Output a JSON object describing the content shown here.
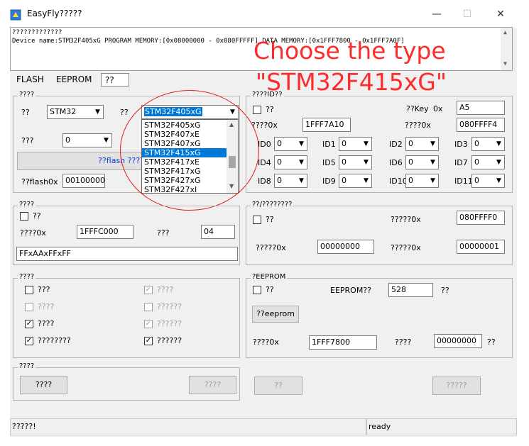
{
  "window": {
    "title": "EasyFly?????",
    "minimize": "—",
    "maximize": "☐",
    "close": "✕"
  },
  "log": {
    "lines": [
      "?????????????",
      "Device name:STM32F405xG PROGRAM MEMORY:[0x08000000 - 0x080FFFFF] DATA MEMORY:[0x1FFF7800 - 0x1FFF7A0F]"
    ]
  },
  "annotation": {
    "line1": "Choose the type",
    "line2": "\"STM32F415xG\""
  },
  "tabs": [
    {
      "label": "FLASH"
    },
    {
      "label": "EEPROM"
    },
    {
      "label": "??"
    }
  ],
  "device_group": {
    "label": "????",
    "family_label": "??",
    "family_value": "STM32",
    "model_label": "??",
    "model_value": "STM32F405xG",
    "row2_label": "???",
    "row2_value": "0",
    "flash_button": "??flash ????",
    "flash0x_label": "??flash0x",
    "flash0x_value": "00100000"
  },
  "dropdown": {
    "options": [
      "STM32F405xG",
      "STM32F407xE",
      "STM32F407xG",
      "STM32F415xG",
      "STM32F417xE",
      "STM32F417xG",
      "STM32F427xG",
      "STM32F427xI"
    ],
    "highlighted": "STM32F415xG"
  },
  "id_group": {
    "label": "????ID??",
    "check_label": "??",
    "key_label": "??Key",
    "key_prefix": "0x",
    "key_value": "A5",
    "addr_label": "????0x",
    "addr_value": "1FFF7A10",
    "addr2_label": "????0x",
    "addr2_value": "080FFFF4",
    "ids": [
      {
        "label": "ID0",
        "value": "0"
      },
      {
        "label": "ID1",
        "value": "0"
      },
      {
        "label": "ID2",
        "value": "0"
      },
      {
        "label": "ID3",
        "value": "0"
      },
      {
        "label": "ID4",
        "value": "0"
      },
      {
        "label": "ID5",
        "value": "0"
      },
      {
        "label": "ID6",
        "value": "0"
      },
      {
        "label": "ID7",
        "value": "0"
      },
      {
        "label": "ID8",
        "value": "0"
      },
      {
        "label": "ID9",
        "value": "0"
      },
      {
        "label": "ID10",
        "value": "0"
      },
      {
        "label": "ID11",
        "value": "0"
      }
    ]
  },
  "option_group": {
    "label": "????",
    "check_label": "??",
    "addr_label": "????0x",
    "addr_value": "1FFFC000",
    "len_label": "???",
    "len_value": "04",
    "bytes_value": "FFxAAxFFxFF"
  },
  "serial_group": {
    "label": "??/????????",
    "check_label": "??",
    "addr_label": "?????0x",
    "addr_value": "080FFFF0",
    "start_label": "?????0x",
    "start_value": "00000000",
    "step_label": "?????0x",
    "step_value": "00000001"
  },
  "ops_group": {
    "label": "????",
    "items": [
      {
        "label": "???",
        "checked": false,
        "disabled": false
      },
      {
        "label": "????",
        "checked": true,
        "disabled": true
      },
      {
        "label": "????",
        "checked": false,
        "disabled": true
      },
      {
        "label": "??????",
        "checked": false,
        "disabled": true
      },
      {
        "label": "????",
        "checked": true,
        "disabled": false
      },
      {
        "label": "??????",
        "checked": true,
        "disabled": true
      },
      {
        "label": "????????",
        "checked": true,
        "disabled": false
      },
      {
        "label": "??????",
        "checked": true,
        "disabled": false
      }
    ]
  },
  "eeprom_group": {
    "label": "?EEPROM",
    "check_label": "??",
    "size_label": "EEPROM??",
    "size_value": "528",
    "size_unit": "??",
    "button": "??eeprom",
    "addr_label": "????0x",
    "addr_value": "1FFF7800",
    "data_label": "????",
    "data_value": "00000000",
    "data_unit": "??"
  },
  "action_group": {
    "label": "????",
    "button1": "????",
    "button2": "????"
  },
  "bottom_buttons": {
    "button3": "??",
    "button4": "?????"
  },
  "status": {
    "left": "?????!",
    "right": "ready"
  }
}
